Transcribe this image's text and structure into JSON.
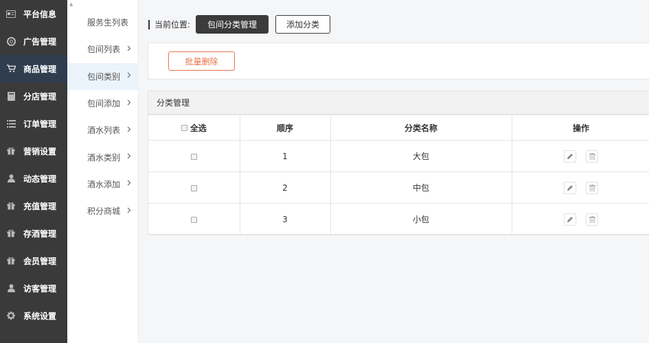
{
  "sidebar": {
    "items": [
      {
        "label": "平台信息",
        "icon": "card-icon"
      },
      {
        "label": "广告管理",
        "icon": "lifebuoy-icon"
      },
      {
        "label": "商品管理",
        "icon": "cart-icon",
        "active": true
      },
      {
        "label": "分店管理",
        "icon": "book-icon"
      },
      {
        "label": "订单管理",
        "icon": "list-icon"
      },
      {
        "label": "营销设置",
        "icon": "gift-icon"
      },
      {
        "label": "动态管理",
        "icon": "user-icon"
      },
      {
        "label": "充值管理",
        "icon": "gift-icon"
      },
      {
        "label": "存酒管理",
        "icon": "gift-icon"
      },
      {
        "label": "会员管理",
        "icon": "gift-icon"
      },
      {
        "label": "访客管理",
        "icon": "user-icon"
      },
      {
        "label": "系统设置",
        "icon": "gear-icon"
      }
    ]
  },
  "subnav": {
    "items": [
      {
        "label": "服务生列表",
        "chevron": false
      },
      {
        "label": "包间列表",
        "chevron": true
      },
      {
        "label": "包间类别",
        "chevron": true,
        "active": true
      },
      {
        "label": "包间添加",
        "chevron": true
      },
      {
        "label": "酒水列表",
        "chevron": true
      },
      {
        "label": "酒水类别",
        "chevron": true
      },
      {
        "label": "酒水添加",
        "chevron": true
      },
      {
        "label": "积分商城",
        "chevron": true
      }
    ]
  },
  "breadcrumb": {
    "label": "当前位置:",
    "current": "包间分类管理",
    "add_button": "添加分类"
  },
  "actions": {
    "batch_delete": "批量删除"
  },
  "table": {
    "panel_title": "分类管理",
    "headers": {
      "select_all": "全选",
      "order": "顺序",
      "name": "分类名称",
      "ops": "操作"
    },
    "rows": [
      {
        "order": "1",
        "name": "大包"
      },
      {
        "order": "2",
        "name": "中包"
      },
      {
        "order": "3",
        "name": "小包"
      }
    ]
  },
  "colors": {
    "sidebar_bg": "#3a3a3a",
    "sidebar_active": "#2f3d4f",
    "danger": "#e8734a",
    "dark_button": "#3b3b3b"
  }
}
